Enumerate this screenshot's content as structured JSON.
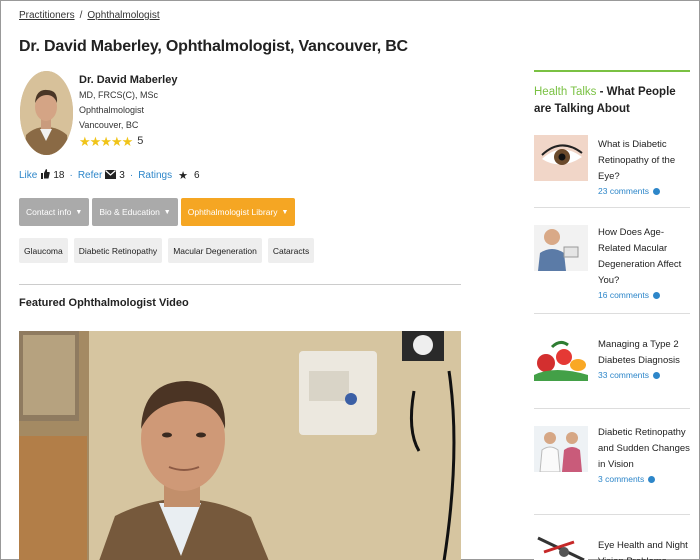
{
  "breadcrumb": {
    "root": "Practitioners",
    "separator": "/",
    "current": "Ophthalmologist"
  },
  "page_title": "Dr. David Maberley, Ophthalmologist, Vancouver, BC",
  "profile": {
    "name": "Dr. David Maberley",
    "credentials": "MD, FRCS(C), MSc",
    "specialty": "Ophthalmologist",
    "location": "Vancouver, BC",
    "stars": "★★★★★",
    "rating": "5",
    "star_color": "#f0c419"
  },
  "actions": {
    "like_label": "Like",
    "like_count": "18",
    "refer_label": "Refer",
    "refer_count": "3",
    "ratings_label": "Ratings",
    "ratings_count": "6",
    "link_color": "#2d86c9"
  },
  "buttons": [
    {
      "label": "Contact info"
    },
    {
      "label": "Bio & Education"
    },
    {
      "label": "Ophthalmologist Library"
    }
  ],
  "tags": [
    "Glaucoma",
    "Diabetic Retinopathy",
    "Macular Degeneration",
    "Cataracts"
  ],
  "featured": {
    "title": "Featured Ophthalmologist Video"
  },
  "sidebar": {
    "heading_accent": "Health Talks",
    "heading_rest": " - What People are Talking About",
    "accent_color": "#7ac143",
    "talks": [
      {
        "title": "What is Diabetic Retinopathy of the Eye?",
        "comments": "23 comments"
      },
      {
        "title": "How Does Age-Related Macular Degeneration Affect You?",
        "comments": "16 comments"
      },
      {
        "title": "Managing a Type 2 Diabetes Diagnosis",
        "comments": "33 comments"
      },
      {
        "title": "Diabetic Retinopathy and Sudden Changes in Vision",
        "comments": "3 comments"
      },
      {
        "title": "Eye Health and Night Vision Problems",
        "comments": ""
      }
    ]
  }
}
